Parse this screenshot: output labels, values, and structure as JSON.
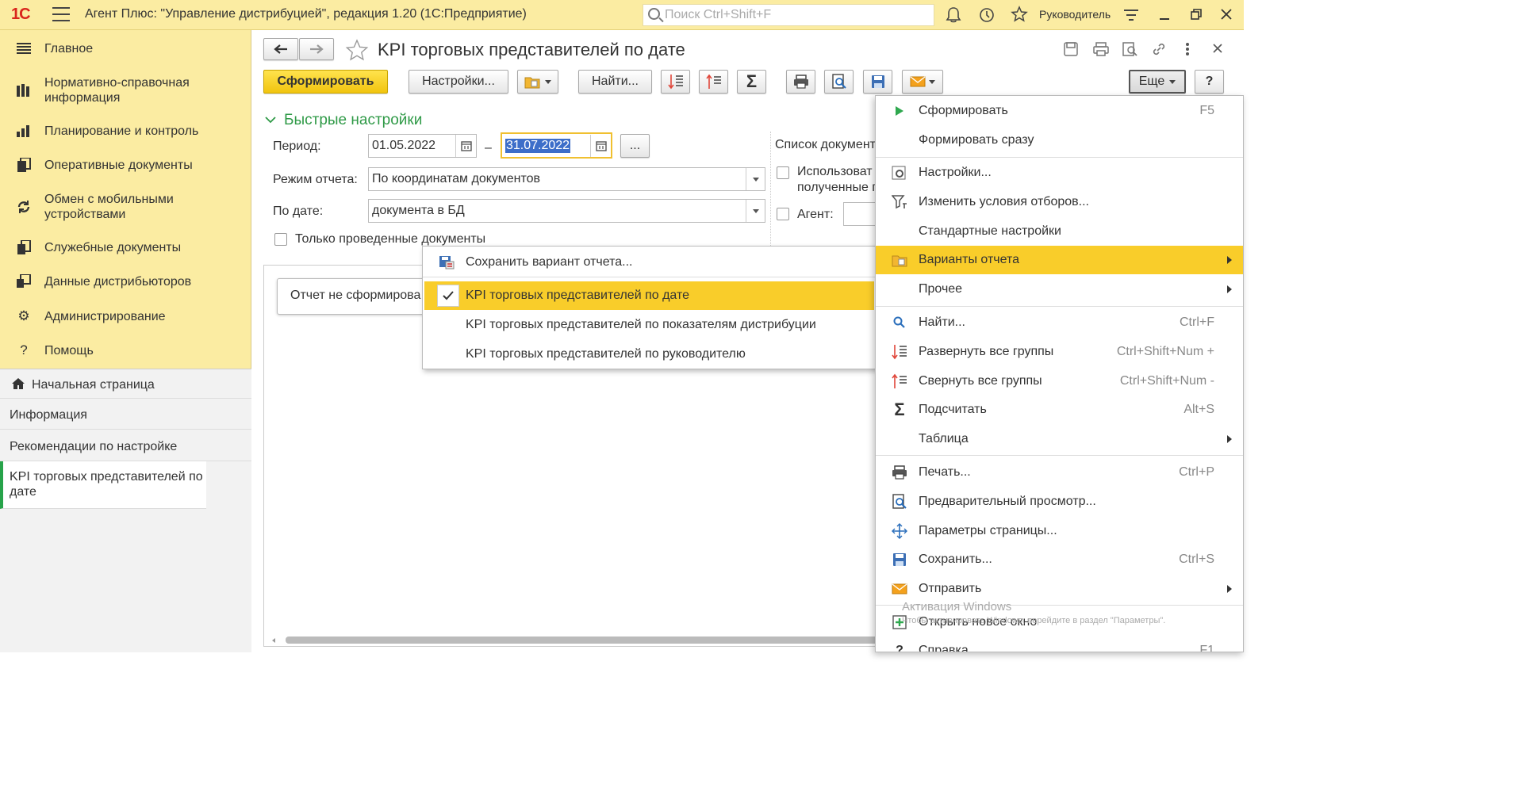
{
  "titlebar": {
    "logo": "1С",
    "title": "Агент Плюс: \"Управление дистрибуцией\", редакция 1.20  (1С:Предприятие)",
    "search_placeholder": "Поиск Ctrl+Shift+F",
    "user": "Руководитель"
  },
  "sidebar": {
    "items": [
      {
        "label": "Главное",
        "icon": "list-icon"
      },
      {
        "label": "Нормативно-справочная информация",
        "icon": "books-icon"
      },
      {
        "label": "Планирование и контроль",
        "icon": "bar-chart-icon"
      },
      {
        "label": "Оперативные документы",
        "icon": "documents-icon"
      },
      {
        "label": "Обмен с мобильными устройствами",
        "icon": "sync-icon"
      },
      {
        "label": "Служебные документы",
        "icon": "service-docs-icon"
      },
      {
        "label": "Данные дистрибьюторов",
        "icon": "distributor-icon"
      },
      {
        "label": "Администрирование",
        "icon": "gear-icon"
      },
      {
        "label": "Помощь",
        "icon": "question-icon"
      }
    ],
    "nav": [
      {
        "label": "Начальная страница",
        "icon": "home-icon"
      },
      {
        "label": "Информация"
      },
      {
        "label": "Рекомендации по настройке"
      },
      {
        "label": "KPI торговых представителей по дате"
      }
    ]
  },
  "main": {
    "title": "KPI торговых представителей по дате",
    "toolbar": {
      "form_label": "Сформировать",
      "settings_label": "Настройки...",
      "find_label": "Найти...",
      "more_label": "Еще",
      "help_label": "?"
    },
    "quick_settings_label": "Быстрые настройки",
    "period_label": "Период:",
    "period_from": "01.05.2022",
    "period_to": "31.07.2022",
    "period_dash": "–",
    "period_more": "...",
    "mode_label": "Режим отчета:",
    "mode_value": "По координатам документов",
    "bydate_label": "По дате:",
    "bydate_value": "документа в БД",
    "posted_only_label": "Только проведенные документы",
    "doclist_label": "Список документ",
    "use_label_1": "Использоват",
    "use_label_2": "полученные г",
    "agent_label": "Агент:",
    "report_status": "Отчет не сформирова"
  },
  "variants_popup": {
    "save_label": "Сохранить вариант отчета...",
    "items": [
      "KPI торговых представителей по дате",
      "KPI торговых представителей по показателям дистрибуции",
      "KPI торговых представителей по руководителю"
    ]
  },
  "more_menu": {
    "items": [
      {
        "label": "Сформировать",
        "shortcut": "F5",
        "icon": "play-icon"
      },
      {
        "label": "Формировать сразу",
        "shortcut": ""
      },
      {
        "label": "Настройки...",
        "shortcut": "",
        "icon": "settings-icon"
      },
      {
        "label": "Изменить условия отборов...",
        "shortcut": "",
        "icon": "filter-icon"
      },
      {
        "label": "Стандартные настройки",
        "shortcut": ""
      },
      {
        "label": "Варианты отчета",
        "shortcut": "",
        "icon": "variants-icon"
      },
      {
        "label": "Прочее",
        "shortcut": ""
      },
      {
        "label": "Найти...",
        "shortcut": "Ctrl+F",
        "icon": "search-icon"
      },
      {
        "label": "Развернуть все группы",
        "shortcut": "Ctrl+Shift+Num +",
        "icon": "expand-icon"
      },
      {
        "label": "Свернуть все группы",
        "shortcut": "Ctrl+Shift+Num -",
        "icon": "collapse-icon"
      },
      {
        "label": "Подсчитать",
        "shortcut": "Alt+S",
        "icon": "sigma-icon"
      },
      {
        "label": "Таблица",
        "shortcut": ""
      },
      {
        "label": "Печать...",
        "shortcut": "Ctrl+P",
        "icon": "print-icon"
      },
      {
        "label": "Предварительный просмотр...",
        "shortcut": "",
        "icon": "preview-icon"
      },
      {
        "label": "Параметры страницы...",
        "shortcut": "",
        "icon": "page-setup-icon"
      },
      {
        "label": "Сохранить...",
        "shortcut": "Ctrl+S",
        "icon": "save-icon"
      },
      {
        "label": "Отправить",
        "shortcut": "",
        "icon": "mail-icon"
      },
      {
        "label": "Открыть новое окно",
        "shortcut": "",
        "icon": "new-window-icon"
      },
      {
        "label": "Справка",
        "shortcut": "F1"
      }
    ]
  },
  "watermark": {
    "line1": "Активация Windows",
    "line2": "Чтобы активировать Windows, перейдите в раздел \"Параметры\"."
  }
}
